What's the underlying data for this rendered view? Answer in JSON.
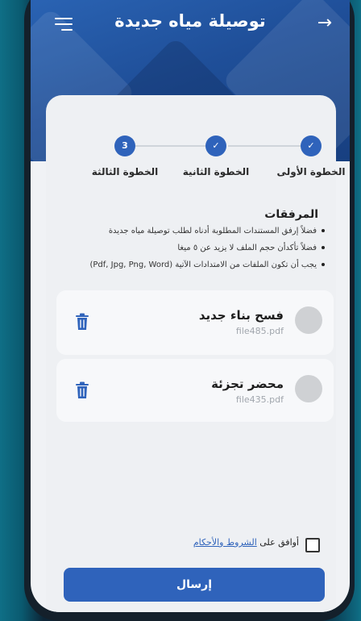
{
  "header": {
    "title": "توصيلة مياه جديدة",
    "back_icon": "arrow-right-icon",
    "menu_icon": "hamburger-menu-icon"
  },
  "stepper": {
    "steps": [
      {
        "label": "الخطوة الأولى",
        "status": "done",
        "indicator": "✓"
      },
      {
        "label": "الخطوة الثانية",
        "status": "done",
        "indicator": "✓"
      },
      {
        "label": "الخطوة الثالثة",
        "status": "current",
        "indicator": "3"
      }
    ]
  },
  "attachments": {
    "title": "المرفقات",
    "notes": [
      "فضلاً إرفق المستندات المطلوبة أدناه لطلب توصيلة مياه جديدة",
      "فضلاً تأكدأن حجم الملف لا يزيد عن ٥ ميغا",
      "يجب أن تكون الملفات من الامتدادات الآتية (Pdf, Jpg, Png, Word)"
    ],
    "files": [
      {
        "name": "فسح بناء جديد",
        "file": "file485.pdf"
      },
      {
        "name": "محضر تجزئة",
        "file": "file435.pdf"
      }
    ]
  },
  "terms": {
    "prefix": "أوافق على ",
    "link": "الشروط والأحكام"
  },
  "submit_label": "إرسال",
  "colors": {
    "primary": "#2f63bb",
    "header": "#1f4f99"
  }
}
